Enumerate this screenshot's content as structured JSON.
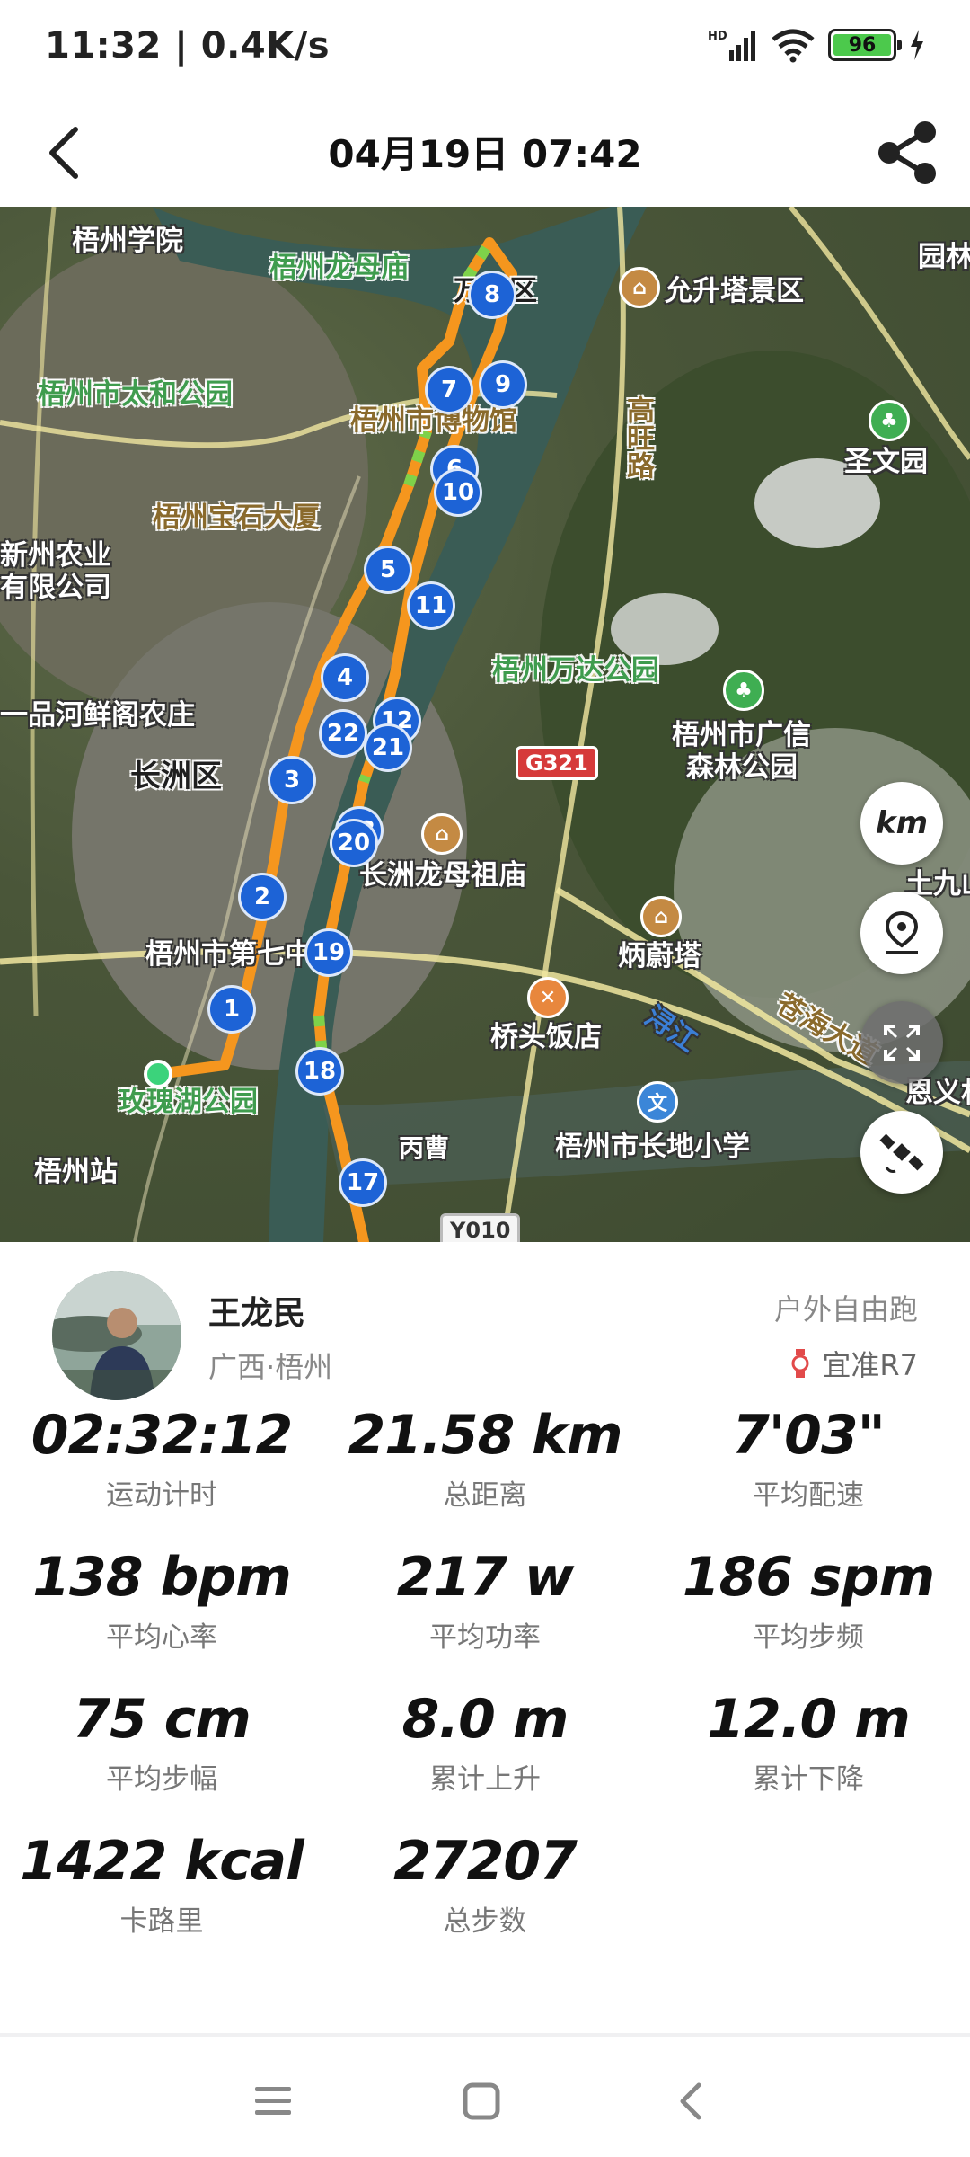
{
  "status_bar": {
    "time": "11:32 | 0.4K/s",
    "battery": "96"
  },
  "header": {
    "title": "04月19日 07:42"
  },
  "map": {
    "places": [
      {
        "text": "梧州学院",
        "style": "white"
      },
      {
        "text": "梧州龙母庙",
        "style": "green"
      },
      {
        "text": "万秀区",
        "style": "dark"
      },
      {
        "text": "允升塔景区",
        "style": "white"
      },
      {
        "text": "园林",
        "style": "white"
      },
      {
        "text": "梧州市太和公园",
        "style": "green"
      },
      {
        "text": "梧州市博物馆",
        "style": "brown"
      },
      {
        "text": "高旺路",
        "style": "brown"
      },
      {
        "text": "圣文园",
        "style": "white"
      },
      {
        "text": "梧州宝石大厦",
        "style": "brown"
      },
      {
        "text": "新州农业",
        "style": "white"
      },
      {
        "text": "有限公司",
        "style": "white"
      },
      {
        "text": "梧州万达公园",
        "style": "green"
      },
      {
        "text": "一品河鲜阁农庄",
        "style": "white"
      },
      {
        "text": "梧州市广信",
        "style": "white"
      },
      {
        "text": "森林公园",
        "style": "white"
      },
      {
        "text": "长洲区",
        "style": "dark"
      },
      {
        "text": "长洲龙母祖庙",
        "style": "white"
      },
      {
        "text": "土九山",
        "style": "white"
      },
      {
        "text": "梧州市第七中学",
        "style": "white"
      },
      {
        "text": "炳蔚塔",
        "style": "white"
      },
      {
        "text": "桥头饭店",
        "style": "white"
      },
      {
        "text": "浔江",
        "style": "white"
      },
      {
        "text": "苍海大道",
        "style": "brown"
      },
      {
        "text": "玫瑰湖公园",
        "style": "green"
      },
      {
        "text": "梧州市长地小学",
        "style": "white"
      },
      {
        "text": "恩义村",
        "style": "white"
      },
      {
        "text": "梧州站",
        "style": "white"
      },
      {
        "text": "丙曹",
        "style": "white"
      }
    ],
    "road_signs": [
      "G321",
      "Y010"
    ],
    "km_markers": [
      "1",
      "2",
      "3",
      "4",
      "5",
      "6",
      "7",
      "8",
      "9",
      "10",
      "11",
      "12",
      "13",
      "17",
      "18",
      "19",
      "20",
      "21",
      "22"
    ],
    "controls": {
      "unit": "km"
    }
  },
  "profile": {
    "name": "王龙民",
    "location": "广西·梧州",
    "sport_type": "户外自由跑",
    "device": "宜准R7"
  },
  "stats": [
    {
      "value": "02:32:12",
      "label": "运动计时"
    },
    {
      "value": "21.58 km",
      "label": "总距离"
    },
    {
      "value": "7'03\"",
      "label": "平均配速"
    },
    {
      "value": "138 bpm",
      "label": "平均心率"
    },
    {
      "value": "217 w",
      "label": "平均功率"
    },
    {
      "value": "186 spm",
      "label": "平均步频"
    },
    {
      "value": "75 cm",
      "label": "平均步幅"
    },
    {
      "value": "8.0 m",
      "label": "累计上升"
    },
    {
      "value": "12.0 m",
      "label": "累计下降"
    },
    {
      "value": "1422 kcal",
      "label": "卡路里"
    },
    {
      "value": "27207",
      "label": "总步数"
    }
  ]
}
